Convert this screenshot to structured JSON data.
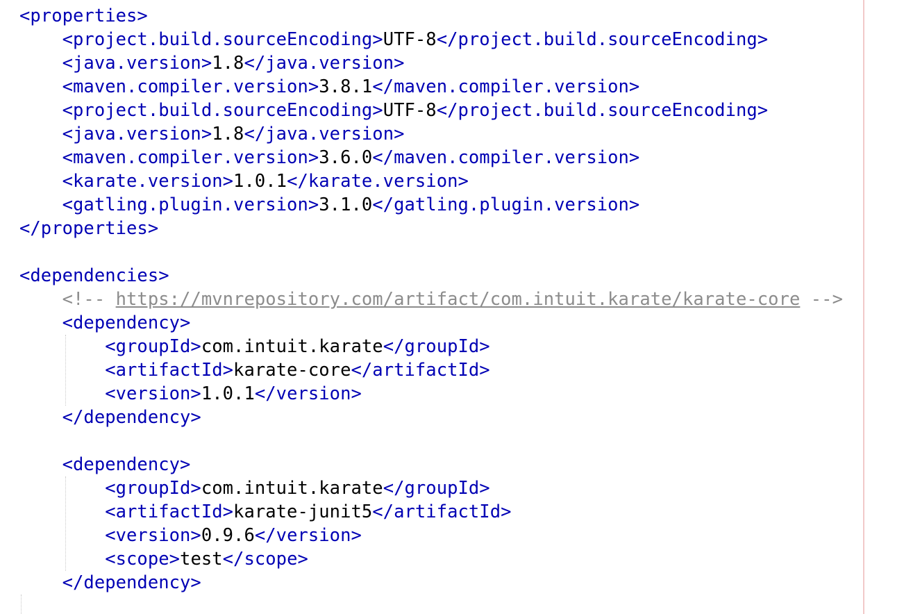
{
  "editor": {
    "indent": "    ",
    "lines": [
      {
        "indent": 0,
        "parts": [
          {
            "c": "tag",
            "t": "<properties>"
          }
        ]
      },
      {
        "indent": 1,
        "parts": [
          {
            "c": "tag",
            "t": "<project.build.sourceEncoding>"
          },
          {
            "c": "txt",
            "t": "UTF-8"
          },
          {
            "c": "tag",
            "t": "</project.build.sourceEncoding>"
          }
        ]
      },
      {
        "indent": 1,
        "parts": [
          {
            "c": "tag",
            "t": "<java.version>"
          },
          {
            "c": "txt",
            "t": "1.8"
          },
          {
            "c": "tag",
            "t": "</java.version>"
          }
        ]
      },
      {
        "indent": 1,
        "parts": [
          {
            "c": "tag",
            "t": "<maven.compiler.version>"
          },
          {
            "c": "txt",
            "t": "3.8.1"
          },
          {
            "c": "tag",
            "t": "</maven.compiler.version>"
          }
        ]
      },
      {
        "indent": 1,
        "parts": [
          {
            "c": "tag",
            "t": "<project.build.sourceEncoding>"
          },
          {
            "c": "txt",
            "t": "UTF-8"
          },
          {
            "c": "tag",
            "t": "</project.build.sourceEncoding>"
          }
        ]
      },
      {
        "indent": 1,
        "parts": [
          {
            "c": "tag",
            "t": "<java.version>"
          },
          {
            "c": "txt",
            "t": "1.8"
          },
          {
            "c": "tag",
            "t": "</java.version>"
          }
        ]
      },
      {
        "indent": 1,
        "parts": [
          {
            "c": "tag",
            "t": "<maven.compiler.version>"
          },
          {
            "c": "txt",
            "t": "3.6.0"
          },
          {
            "c": "tag",
            "t": "</maven.compiler.version>"
          }
        ]
      },
      {
        "indent": 1,
        "parts": [
          {
            "c": "tag",
            "t": "<karate.version>"
          },
          {
            "c": "txt",
            "t": "1.0.1"
          },
          {
            "c": "tag",
            "t": "</karate.version>"
          }
        ]
      },
      {
        "indent": 1,
        "parts": [
          {
            "c": "tag",
            "t": "<gatling.plugin.version>"
          },
          {
            "c": "txt",
            "t": "3.1.0"
          },
          {
            "c": "tag",
            "t": "</gatling.plugin.version>"
          }
        ]
      },
      {
        "indent": 0,
        "parts": [
          {
            "c": "tag",
            "t": "</properties>"
          }
        ]
      },
      {
        "indent": 0,
        "parts": []
      },
      {
        "indent": 0,
        "parts": [
          {
            "c": "tag",
            "t": "<dependencies>"
          }
        ]
      },
      {
        "indent": 1,
        "parts": [
          {
            "c": "cmt",
            "t": "<!-- "
          },
          {
            "c": "url",
            "t": "https://mvnrepository.com/artifact/com.intuit.karate/karate-core"
          },
          {
            "c": "cmt",
            "t": " -->"
          }
        ]
      },
      {
        "indent": 1,
        "parts": [
          {
            "c": "tag",
            "t": "<dependency>"
          }
        ]
      },
      {
        "indent": 2,
        "parts": [
          {
            "c": "tag",
            "t": "<groupId>"
          },
          {
            "c": "txt",
            "t": "com.intuit.karate"
          },
          {
            "c": "tag",
            "t": "</groupId>"
          }
        ]
      },
      {
        "indent": 2,
        "parts": [
          {
            "c": "tag",
            "t": "<artifactId>"
          },
          {
            "c": "txt",
            "t": "karate-core"
          },
          {
            "c": "tag",
            "t": "</artifactId>"
          }
        ]
      },
      {
        "indent": 2,
        "parts": [
          {
            "c": "tag",
            "t": "<version>"
          },
          {
            "c": "txt",
            "t": "1.0.1"
          },
          {
            "c": "tag",
            "t": "</version>"
          }
        ]
      },
      {
        "indent": 1,
        "parts": [
          {
            "c": "tag",
            "t": "</dependency>"
          }
        ]
      },
      {
        "indent": 0,
        "parts": []
      },
      {
        "indent": 1,
        "parts": [
          {
            "c": "tag",
            "t": "<dependency>"
          }
        ]
      },
      {
        "indent": 2,
        "parts": [
          {
            "c": "tag",
            "t": "<groupId>"
          },
          {
            "c": "txt",
            "t": "com.intuit.karate"
          },
          {
            "c": "tag",
            "t": "</groupId>"
          }
        ]
      },
      {
        "indent": 2,
        "parts": [
          {
            "c": "tag",
            "t": "<artifactId>"
          },
          {
            "c": "txt",
            "t": "karate-junit5"
          },
          {
            "c": "tag",
            "t": "</artifactId>"
          }
        ]
      },
      {
        "indent": 2,
        "parts": [
          {
            "c": "tag",
            "t": "<version>"
          },
          {
            "c": "txt",
            "t": "0.9.6"
          },
          {
            "c": "tag",
            "t": "</version>"
          }
        ]
      },
      {
        "indent": 2,
        "parts": [
          {
            "c": "tag",
            "t": "<scope>"
          },
          {
            "c": "txt",
            "t": "test"
          },
          {
            "c": "tag",
            "t": "</scope>"
          }
        ]
      },
      {
        "indent": 1,
        "parts": [
          {
            "c": "tag",
            "t": "</dependency>"
          }
        ]
      }
    ]
  }
}
